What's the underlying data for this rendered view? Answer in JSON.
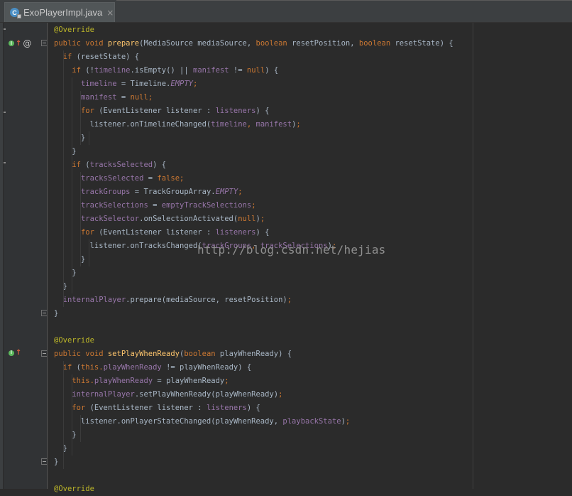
{
  "editor_tab": {
    "title": "ExoPlayerImpl.java",
    "close_glyph": "×",
    "icon": "java-class-icon"
  },
  "watermark": "http://blog.csdn.net/hejias",
  "gutter_icons": [
    "implements-icon",
    "up-arrow-icon",
    "at-icon",
    "fold-icon"
  ],
  "colors": {
    "background": "#2b2b2b",
    "gutter": "#313335",
    "keyword": "#cc7832",
    "annotation": "#bbb529",
    "field": "#9876aa",
    "method": "#ffc66d",
    "text": "#a9b7c6"
  },
  "code_lines": [
    [
      [
        "an",
        "@Override"
      ]
    ],
    [
      [
        "kw",
        "public void "
      ],
      [
        "mt",
        "prepare"
      ],
      [
        "pc",
        "(MediaSource mediaSource, "
      ],
      [
        "kw",
        "boolean "
      ],
      [
        "pc",
        "resetPosition, "
      ],
      [
        "kw",
        "boolean "
      ],
      [
        "pc",
        "resetState) {"
      ]
    ],
    [
      [
        "pc",
        "  "
      ],
      [
        "kw",
        "if "
      ],
      [
        "pc",
        "(resetState) {"
      ]
    ],
    [
      [
        "pc",
        "    "
      ],
      [
        "kw",
        "if "
      ],
      [
        "pc",
        "(!"
      ],
      [
        "fd",
        "timeline"
      ],
      [
        "pc",
        ".isEmpty() || "
      ],
      [
        "fd",
        "manifest "
      ],
      [
        "pc",
        "!= "
      ],
      [
        "kw",
        "null"
      ],
      [
        "pc",
        ") {"
      ]
    ],
    [
      [
        "pc",
        "      "
      ],
      [
        "fd",
        "timeline "
      ],
      [
        "pc",
        "= Timeline."
      ],
      [
        "st",
        "EMPTY"
      ],
      [
        "kw",
        ";"
      ]
    ],
    [
      [
        "pc",
        "      "
      ],
      [
        "fd",
        "manifest "
      ],
      [
        "pc",
        "= "
      ],
      [
        "kw",
        "null;"
      ]
    ],
    [
      [
        "pc",
        "      "
      ],
      [
        "kw",
        "for "
      ],
      [
        "pc",
        "(EventListener listener : "
      ],
      [
        "fd",
        "listeners"
      ],
      [
        "pc",
        ") {"
      ]
    ],
    [
      [
        "pc",
        "        listener.onTimelineChanged("
      ],
      [
        "fd",
        "timeline"
      ],
      [
        "kw",
        ", "
      ],
      [
        "fd",
        "manifest"
      ],
      [
        "pc",
        ")"
      ],
      [
        "kw",
        ";"
      ]
    ],
    [
      [
        "pc",
        "      }"
      ]
    ],
    [
      [
        "pc",
        "    }"
      ]
    ],
    [
      [
        "pc",
        "    "
      ],
      [
        "kw",
        "if "
      ],
      [
        "pc",
        "("
      ],
      [
        "fd",
        "tracksSelected"
      ],
      [
        "pc",
        ") {"
      ]
    ],
    [
      [
        "pc",
        "      "
      ],
      [
        "fd",
        "tracksSelected "
      ],
      [
        "pc",
        "= "
      ],
      [
        "kw",
        "false;"
      ]
    ],
    [
      [
        "pc",
        "      "
      ],
      [
        "fd",
        "trackGroups "
      ],
      [
        "pc",
        "= TrackGroupArray."
      ],
      [
        "st",
        "EMPTY"
      ],
      [
        "kw",
        ";"
      ]
    ],
    [
      [
        "pc",
        "      "
      ],
      [
        "fd",
        "trackSelections "
      ],
      [
        "pc",
        "= "
      ],
      [
        "fd",
        "emptyTrackSelections"
      ],
      [
        "kw",
        ";"
      ]
    ],
    [
      [
        "pc",
        "      "
      ],
      [
        "fd",
        "trackSelector"
      ],
      [
        "pc",
        ".onSelectionActivated("
      ],
      [
        "kw",
        "null"
      ],
      [
        "pc",
        ")"
      ],
      [
        "kw",
        ";"
      ]
    ],
    [
      [
        "pc",
        "      "
      ],
      [
        "kw",
        "for "
      ],
      [
        "pc",
        "(EventListener listener : "
      ],
      [
        "fd",
        "listeners"
      ],
      [
        "pc",
        ") {"
      ]
    ],
    [
      [
        "pc",
        "        listener.onTracksChanged("
      ],
      [
        "fd",
        "trackGroups"
      ],
      [
        "kw",
        ", "
      ],
      [
        "fd",
        "trackSelections"
      ],
      [
        "pc",
        ")"
      ],
      [
        "kw",
        ";"
      ]
    ],
    [
      [
        "pc",
        "      }"
      ]
    ],
    [
      [
        "pc",
        "    }"
      ]
    ],
    [
      [
        "pc",
        "  }"
      ]
    ],
    [
      [
        "pc",
        "  "
      ],
      [
        "fd",
        "internalPlayer"
      ],
      [
        "pc",
        ".prepare(mediaSource, resetPosition)"
      ],
      [
        "kw",
        ";"
      ]
    ],
    [
      [
        "pc",
        "}"
      ]
    ],
    [],
    [
      [
        "an",
        "@Override"
      ]
    ],
    [
      [
        "kw",
        "public void "
      ],
      [
        "mt",
        "setPlayWhenReady"
      ],
      [
        "pc",
        "("
      ],
      [
        "kw",
        "boolean "
      ],
      [
        "pc",
        "playWhenReady) {"
      ]
    ],
    [
      [
        "pc",
        "  "
      ],
      [
        "kw",
        "if "
      ],
      [
        "pc",
        "("
      ],
      [
        "kw",
        "this."
      ],
      [
        "fd",
        "playWhenReady "
      ],
      [
        "pc",
        "!= playWhenReady) {"
      ]
    ],
    [
      [
        "pc",
        "    "
      ],
      [
        "kw",
        "this."
      ],
      [
        "fd",
        "playWhenReady "
      ],
      [
        "pc",
        "= playWhenReady"
      ],
      [
        "kw",
        ";"
      ]
    ],
    [
      [
        "pc",
        "    "
      ],
      [
        "fd",
        "internalPlayer"
      ],
      [
        "pc",
        ".setPlayWhenReady(playWhenReady)"
      ],
      [
        "kw",
        ";"
      ]
    ],
    [
      [
        "pc",
        "    "
      ],
      [
        "kw",
        "for "
      ],
      [
        "pc",
        "(EventListener listener : "
      ],
      [
        "fd",
        "listeners"
      ],
      [
        "pc",
        ") {"
      ]
    ],
    [
      [
        "pc",
        "      listener.onPlayerStateChanged(playWhenReady, "
      ],
      [
        "fd",
        "playbackState"
      ],
      [
        "pc",
        ")"
      ],
      [
        "kw",
        ";"
      ]
    ],
    [
      [
        "pc",
        "    }"
      ]
    ],
    [
      [
        "pc",
        "  }"
      ]
    ],
    [
      [
        "pc",
        "}"
      ]
    ],
    [],
    [
      [
        "an",
        "@Override"
      ]
    ]
  ]
}
